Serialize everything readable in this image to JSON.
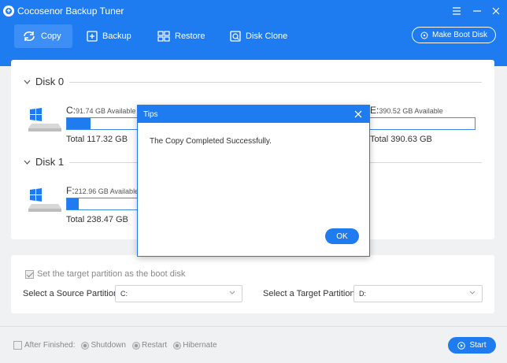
{
  "window": {
    "title": "Cocosenor Backup Tuner"
  },
  "toolbar": {
    "items": [
      {
        "label": "Copy",
        "icon": "copy-icon",
        "active": true
      },
      {
        "label": "Backup",
        "icon": "backup-icon",
        "active": false
      },
      {
        "label": "Restore",
        "icon": "restore-icon",
        "active": false
      },
      {
        "label": "Disk Clone",
        "icon": "disk-clone-icon",
        "active": false
      }
    ],
    "boot_disk_label": "Make Boot Disk"
  },
  "disks": [
    {
      "name": "Disk 0",
      "partitions": [
        {
          "letter": "C:",
          "available": "91.74 GB Available",
          "total": "Total 117.32 GB",
          "used_fraction": 0.22
        },
        {
          "letter": "E:",
          "available": "390.52 GB Available",
          "total": "Total 390.63 GB",
          "used_fraction": 0.0
        }
      ]
    },
    {
      "name": "Disk 1",
      "partitions": [
        {
          "letter": "F:",
          "available": "212.96 GB Available",
          "total": "Total 238.47 GB",
          "used_fraction": 0.11
        }
      ]
    }
  ],
  "options": {
    "boot_checkbox_label": "Set the target partition as the boot disk",
    "boot_checked": true,
    "source_label": "Select a Source Partition:",
    "source_value": "C:",
    "target_label": "Select a Target Partition:",
    "target_value": "D:"
  },
  "bottom": {
    "after_finished_label": "After Finished:",
    "radios": [
      "Shutdown",
      "Restart",
      "Hibernate"
    ],
    "start_label": "Start"
  },
  "modal": {
    "title": "Tips",
    "message": "The Copy Completed Successfully.",
    "ok_label": "OK"
  },
  "colors": {
    "accent": "#1e7cf0",
    "background": "#f0f1f3"
  }
}
